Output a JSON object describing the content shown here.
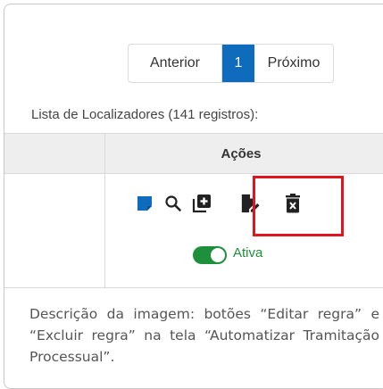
{
  "pagination": {
    "previous_label": "Anterior",
    "current_page": "1",
    "next_label": "Próximo"
  },
  "list_caption": "Lista de Localizadores (141 registros):",
  "table": {
    "actions_header": "Ações"
  },
  "row": {
    "action_icons": [
      "sticky-note-icon",
      "search-icon",
      "add-box-icon",
      "edit-document-icon",
      "delete-icon"
    ],
    "status_toggle_label": "Ativa",
    "status_toggle_on": true
  },
  "colors": {
    "accent": "#0f6cbd",
    "active_green": "#1e8f3a",
    "highlight_red": "#e0151e"
  },
  "description": "Descrição da imagem: botões “Editar regra” e “Excluir regra” na tela “Automatizar Tramitação Processual”."
}
